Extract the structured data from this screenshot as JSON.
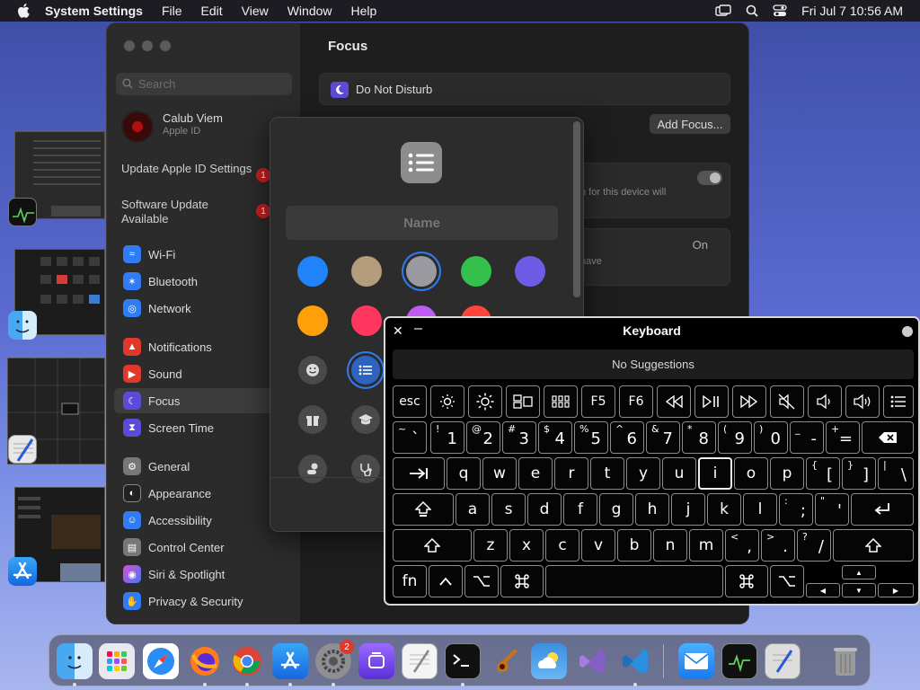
{
  "menubar": {
    "app_name": "System Settings",
    "items": [
      "File",
      "Edit",
      "View",
      "Window",
      "Help"
    ],
    "clock": "Fri Jul 7  10:56 AM"
  },
  "sidebar": {
    "search_placeholder": "Search",
    "account_name": "Calub Viem",
    "account_sub": "Apple ID",
    "notes": [
      {
        "label": "Update Apple ID Settings",
        "badge": "1"
      },
      {
        "label": "Software Update Available",
        "badge": "1"
      }
    ],
    "items": [
      {
        "label": "Wi-Fi",
        "icon": "wifi-icon",
        "color": "#2f7cf6"
      },
      {
        "label": "Bluetooth",
        "icon": "bluetooth-icon",
        "color": "#2f7cf6"
      },
      {
        "label": "Network",
        "icon": "globe-icon",
        "color": "#2f7cf6"
      },
      {
        "label": "Notifications",
        "icon": "bell-icon",
        "color": "#e0392b"
      },
      {
        "label": "Sound",
        "icon": "speaker-icon",
        "color": "#e0392b"
      },
      {
        "label": "Focus",
        "icon": "moon-icon",
        "color": "#5b4bd6"
      },
      {
        "label": "Screen Time",
        "icon": "hourglass-icon",
        "color": "#5b4bd6"
      },
      {
        "label": "General",
        "icon": "gear-icon",
        "color": "#777777"
      },
      {
        "label": "Appearance",
        "icon": "appearance-icon",
        "color": "#222222"
      },
      {
        "label": "Accessibility",
        "icon": "accessibility-icon",
        "color": "#2f7cf6"
      },
      {
        "label": "Control Center",
        "icon": "control-center-icon",
        "color": "#777777"
      },
      {
        "label": "Siri & Spotlight",
        "icon": "siri-icon",
        "color": "#a23ad6"
      },
      {
        "label": "Privacy & Security",
        "icon": "hand-icon",
        "color": "#2f7cf6"
      }
    ],
    "selected": "Focus"
  },
  "main": {
    "title": "Focus",
    "dnd_label": "Do Not Disturb",
    "add_focus": "Add Focus...",
    "panel_text": "n for this device will",
    "panel2_value": "On",
    "panel2_text": "have"
  },
  "sheet": {
    "name_placeholder": "Name",
    "colors": [
      "#1f84fa",
      "#b59c7b",
      "#9a9aa0",
      "#33c04c",
      "#6e5ce6",
      "#ff9f0a",
      "#ff375f",
      "#bf5af2",
      "#ff453a",
      "#40c8e0"
    ],
    "selected_color": "#9a9aa0"
  },
  "keyboard": {
    "title": "Keyboard",
    "suggestions": "No Suggestions",
    "rows": [
      [
        "esc"
      ],
      [
        "~ `",
        "! 1",
        "@ 2",
        "# 3",
        "$ 4",
        "% 5",
        "^ 6",
        "& 7",
        "* 8",
        "( 9",
        ") 0",
        "_ -",
        "+ ="
      ],
      [
        "q",
        "w",
        "e",
        "r",
        "t",
        "y",
        "u",
        "i",
        "o",
        "p",
        "{ [",
        "} ]",
        "| \\"
      ],
      [
        "a",
        "s",
        "d",
        "f",
        "g",
        "h",
        "j",
        "k",
        "l",
        ": ;",
        "\" '"
      ],
      [
        "z",
        "x",
        "c",
        "v",
        "b",
        "n",
        "m",
        "< ,",
        "> .",
        "? /"
      ],
      [
        "fn"
      ]
    ],
    "fkeys": [
      "F5",
      "F6"
    ],
    "highlighted": "i"
  },
  "dock": {
    "badge": "2"
  }
}
